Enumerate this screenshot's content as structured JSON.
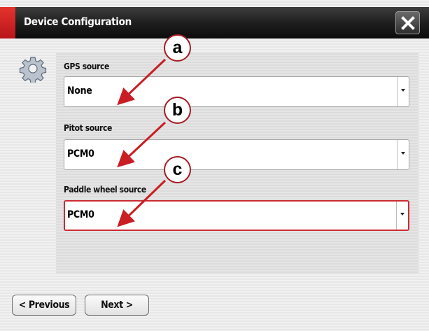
{
  "window": {
    "title": "Device Configuration",
    "close_icon": "close-x-icon"
  },
  "settings_icon": "gear-icon",
  "fields": [
    {
      "label": "GPS source",
      "value": "None",
      "active": false
    },
    {
      "label": "Pitot source",
      "value": "PCM0",
      "active": false
    },
    {
      "label": "Paddle wheel source",
      "value": "PCM0",
      "active": true
    }
  ],
  "nav": {
    "previous_label": "< Previous",
    "next_label": "Next >"
  },
  "callouts": [
    "a",
    "b",
    "c"
  ],
  "colors": {
    "accent_red": "#c81e24",
    "callout_border": "#a51c24",
    "titlebar": "#1f1f1f"
  }
}
